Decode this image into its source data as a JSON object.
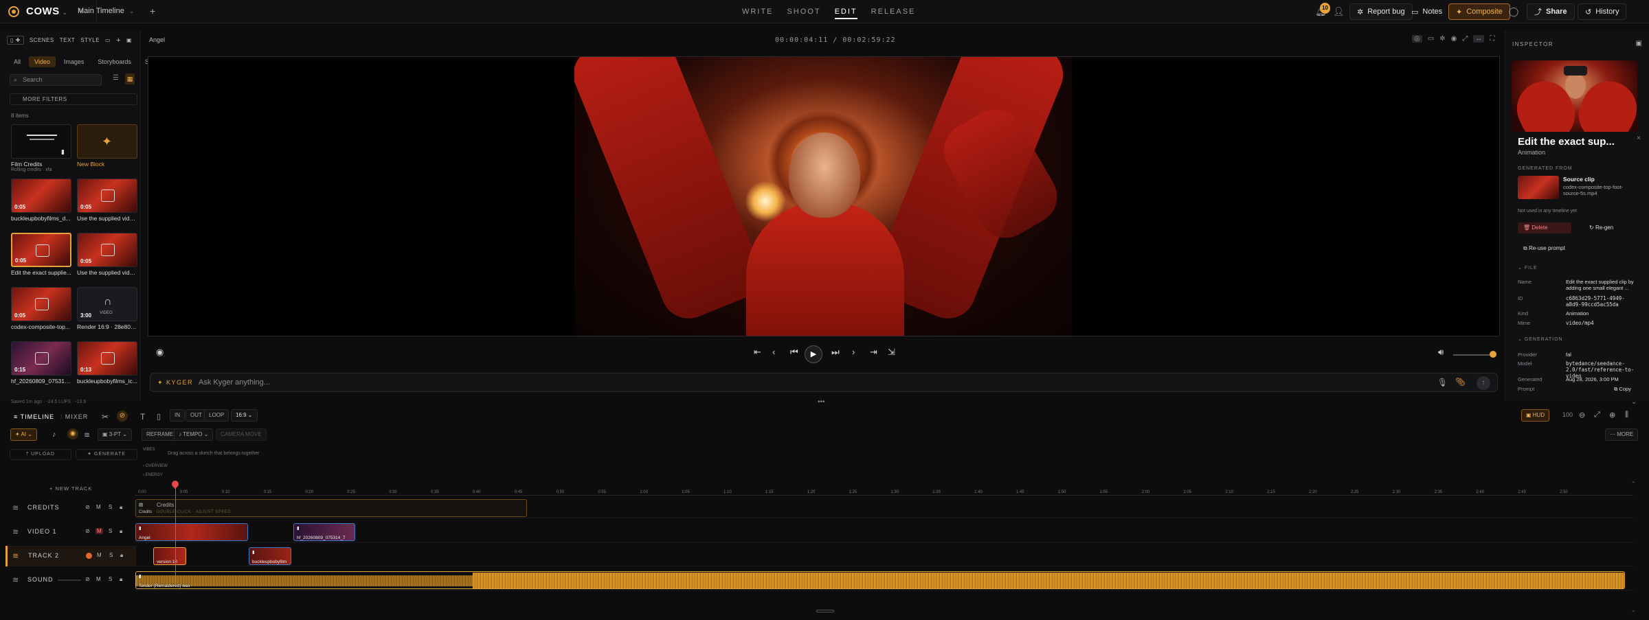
{
  "app": {
    "project": "COWS",
    "timeline": "Main Timeline",
    "modes": [
      "WRITE",
      "SHOOT",
      "EDIT",
      "RELEASE"
    ],
    "active_mode": "EDIT",
    "notif_count": "10",
    "report_bug": "Report bug",
    "notes": "Notes",
    "composite": "Composite",
    "share": "Share",
    "history": "History"
  },
  "left": {
    "tabs": [
      "SCENES",
      "TEXT",
      "STYLE"
    ],
    "filters": [
      "All",
      "Video",
      "Images",
      "Storyboards",
      "Sou"
    ],
    "active_filter": "Video",
    "search_placeholder": "Search",
    "more_filters": "MORE FILTERS",
    "count": "8 items",
    "cards": [
      {
        "label": "Film Credits",
        "sub": "Rolling credits · xfa",
        "dur": ""
      },
      {
        "label": "New Block",
        "sub": "",
        "dur": ""
      },
      {
        "label": "buckleupbobyfilms_d...",
        "sub": "",
        "dur": "0:05"
      },
      {
        "label": "Use the supplied vide...",
        "sub": "",
        "dur": "0:05"
      },
      {
        "label": "Edit the exact supplie...",
        "sub": "",
        "dur": "0:05"
      },
      {
        "label": "Use the supplied vide...",
        "sub": "",
        "dur": "0:05"
      },
      {
        "label": "codex-composite-top...",
        "sub": "",
        "dur": "0:05"
      },
      {
        "label": "Render 16:9 · 28e80b0d",
        "sub": "",
        "dur": "3:00"
      },
      {
        "label": "hf_20260809_075314...",
        "sub": "",
        "dur": "0:15"
      },
      {
        "label": "buckleupbobyfilms_ic...",
        "sub": "",
        "dur": "0:13"
      }
    ]
  },
  "viewer": {
    "clip_name": "Angel",
    "timecode": "00:00:04:11 / 00:02:59:22"
  },
  "ask": {
    "label": "KYGER",
    "placeholder": "Ask Kyger anything..."
  },
  "status": "Saved 1m ago · -24.5 LUFS · -13.6",
  "inspector": {
    "title": "INSPECTOR",
    "heading": "Edit the exact sup...",
    "kind_label": "Animation",
    "generated_from": "GENERATED FROM",
    "source_title": "Source clip",
    "source_file": "codex-composite-top-foot-source-5s.mp4",
    "not_used": "Not used in any timeline yet.",
    "delete": "Delete",
    "regen": "Re-gen",
    "reuse": "Re-use prompt",
    "file_section": "FILE",
    "file": [
      {
        "k": "Name",
        "v": "Edit the exact supplied clip by adding one small elegant ..."
      },
      {
        "k": "ID",
        "v": "c6863d29-5771-4949-a8d9-99ccd5ac55da"
      },
      {
        "k": "Kind",
        "v": "Animation"
      },
      {
        "k": "Mime",
        "v": "video/mp4"
      }
    ],
    "gen_section": "GENERATION",
    "generation": [
      {
        "k": "Provider",
        "v": "fal"
      },
      {
        "k": "Model",
        "v": "bytedance/seedance-2.0/fast/reference-to-video"
      },
      {
        "k": "Generated",
        "v": "Aug 28, 2026, 3:00 PM"
      },
      {
        "k": "Prompt",
        "v": "Copy"
      }
    ]
  },
  "timeline": {
    "tabs": [
      "TIMELINE",
      "MIXER"
    ],
    "ai": "AI",
    "pt": "3-PT",
    "reframe": "REFRAME",
    "tempo": "TEMPO",
    "camera_move": "CAMERA MOVE",
    "in": "IN",
    "out": "OUT",
    "loop": "LOOP",
    "aspect": "16:9",
    "hud": "HUD",
    "more": "MORE",
    "upload": "UPLOAD",
    "generate": "GENERATE",
    "sketch_hint": "Drag across a sketch that belongs together",
    "sub_labels": [
      "VIBES",
      "OVERVIEW",
      "ENERGY"
    ],
    "new_track": "+ NEW TRACK",
    "ticks": [
      "0:00",
      "0:05",
      "0:10",
      "0:15",
      "0:20",
      "0:25",
      "0:30",
      "0:35",
      "0:40",
      "0:45",
      "0:50",
      "0:55",
      "1:00",
      "1:05",
      "1:10",
      "1:15",
      "1:20",
      "1:25",
      "1:30",
      "1:35",
      "1:40",
      "1:45",
      "1:50",
      "1:55",
      "2:00",
      "2:05",
      "2:10",
      "2:15",
      "2:20",
      "2:25",
      "2:30",
      "2:35",
      "2:40",
      "2:45",
      "2:50"
    ],
    "tracks": [
      {
        "name": "CREDITS"
      },
      {
        "name": "VIDEO 1"
      },
      {
        "name": "TRACK 2"
      },
      {
        "name": "SOUND"
      }
    ],
    "clips": {
      "credits": "Credits",
      "credits_sub": "Credits",
      "credits_hint": "DOUBLE-CLICK · ADJUST SPEED",
      "angel": "Angel",
      "hf": "hf_20260809_075314_7",
      "version": "version 10",
      "buckle": "buckleupbobyfilm",
      "sound": "Tender (Remastered) wav"
    }
  }
}
